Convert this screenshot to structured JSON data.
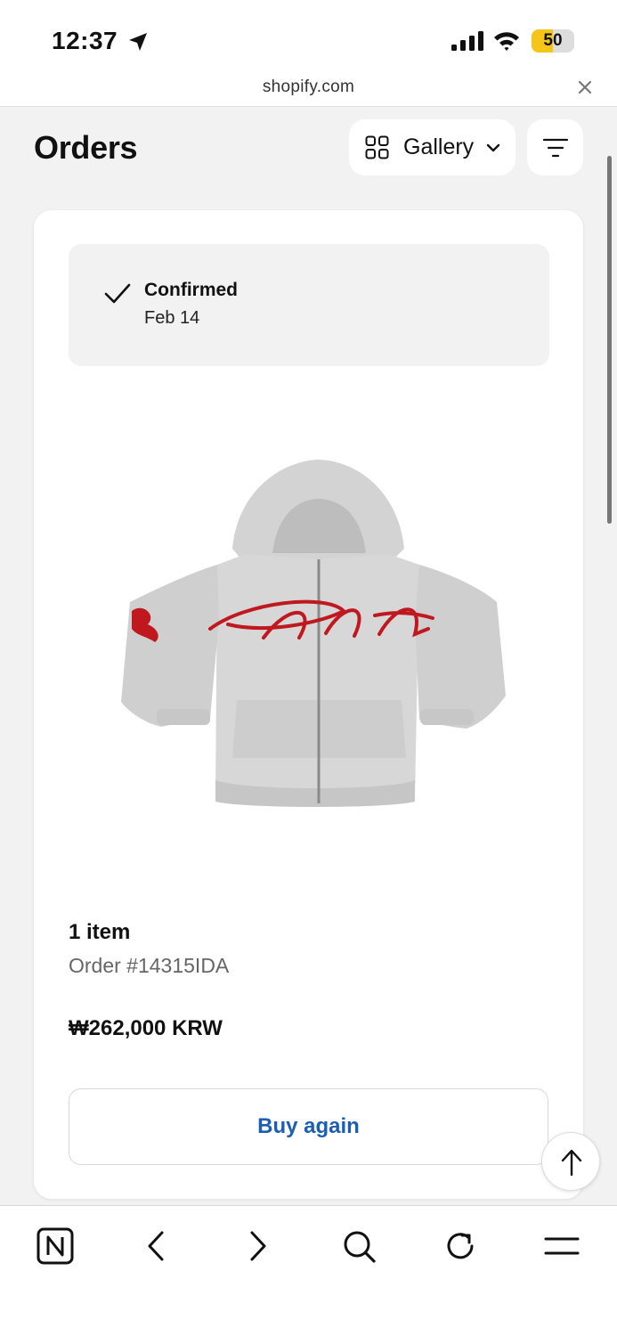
{
  "status_bar": {
    "time": "12:37",
    "battery": "50",
    "battery_level": 0.5,
    "icons": [
      "location-arrow-icon",
      "cellular-signal-icon",
      "wifi-icon",
      "battery-charging-icon"
    ]
  },
  "browser": {
    "url": "shopify.com",
    "close_icon": "close-icon"
  },
  "header": {
    "title": "Orders",
    "view_mode": "Gallery",
    "view_icon": "grid-icon",
    "filter_icon": "filter-icon"
  },
  "order": {
    "status": "Confirmed",
    "status_date": "Feb 14",
    "status_icon": "checkmark-icon",
    "product_image": "grey-zip-hoodie-with-red-script-logo",
    "item_count": "1 item",
    "order_number": "Order #14315IDA",
    "total": "₩262,000 KRW",
    "buy_again_label": "Buy again"
  },
  "scroll_top_icon": "arrow-up-icon",
  "toolbar": {
    "items": [
      "notion-icon",
      "back-icon",
      "forward-icon",
      "search-icon",
      "reload-icon",
      "menu-icon"
    ]
  },
  "colors": {
    "accent": "#1a5fb4",
    "page_bg": "#f2f2f2",
    "card_bg": "#ffffff",
    "battery": "#f5c518",
    "hoodie_print": "#c0181f"
  }
}
